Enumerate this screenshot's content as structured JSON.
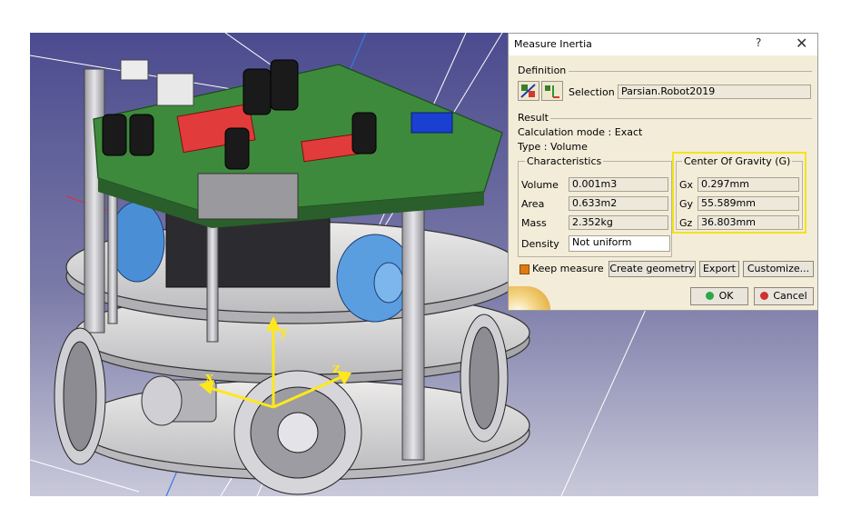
{
  "dialog": {
    "title": "Measure Inertia",
    "help": "?",
    "close": "✕",
    "definition_label": "Definition",
    "selection_label": "Selection :",
    "selection_value": "Parsian.Robot2019",
    "result_label": "Result",
    "calc_mode": "Calculation mode : Exact",
    "type": "Type : Volume",
    "characteristics": {
      "title": "Characteristics",
      "rows": [
        {
          "label": "Volume",
          "value": "0.001m3"
        },
        {
          "label": "Area",
          "value": "0.633m2"
        },
        {
          "label": "Mass",
          "value": "2.352kg"
        },
        {
          "label": "Density",
          "value": "Not uniform"
        }
      ]
    },
    "cog": {
      "title": "Center Of Gravity (G)",
      "rows": [
        {
          "label": "Gx",
          "value": "0.297mm"
        },
        {
          "label": "Gy",
          "value": "55.589mm"
        },
        {
          "label": "Gz",
          "value": "36.803mm"
        }
      ]
    },
    "keep_measure": "Keep measure",
    "buttons": {
      "create_geometry": "Create geometry",
      "export": "Export",
      "customize": "Customize...",
      "ok": "OK",
      "cancel": "Cancel"
    },
    "highlight_color": "#f4e21e"
  },
  "viewport": {
    "axes": {
      "x": "x",
      "y": "y",
      "z": "z"
    },
    "background_top": "#4a4a8c",
    "background_bottom": "#c8c8d8"
  }
}
